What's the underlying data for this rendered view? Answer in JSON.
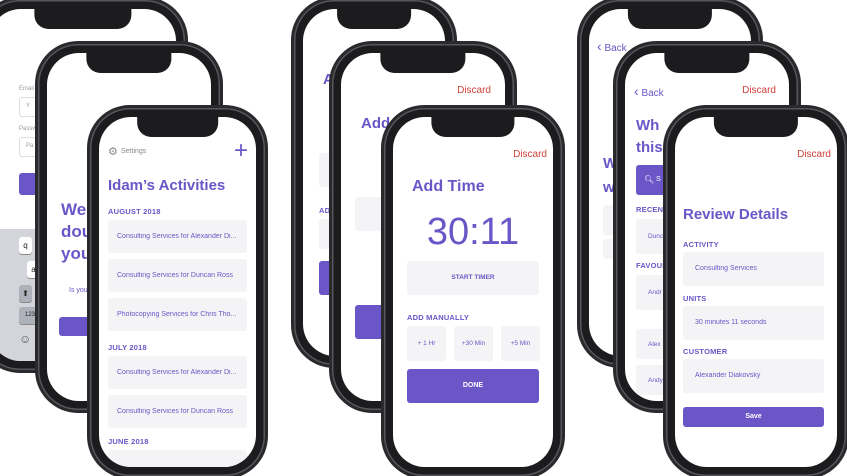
{
  "colors": {
    "accent": "#6a56c7",
    "danger": "#d0403a",
    "card": "#f4f4f6"
  },
  "login": {
    "label_email": "Email",
    "label_password": "Passw",
    "input_email_placeholder": "Y",
    "input_password_placeholder": "Pa",
    "keys": [
      "q",
      "w",
      "a",
      "123"
    ]
  },
  "welcome": {
    "title_lines": [
      "We",
      "dou",
      "you"
    ],
    "body_text": "Is you"
  },
  "activities": {
    "settings_label": "Settings",
    "title": "Idam’s Activities",
    "sections": [
      {
        "heading": "AUGUST 2018",
        "items": [
          "Consulting Services for Alexander Di...",
          "Consulting Services for Duncan Ross",
          "Photocopying Services for Chris Tho..."
        ]
      },
      {
        "heading": "JULY 2018",
        "items": [
          "Consulting Services for Alexander Di...",
          "Consulting Services for Duncan Ross"
        ]
      },
      {
        "heading": "JUNE 2018",
        "items": []
      }
    ]
  },
  "back_add": {
    "title_fragment": "Ad",
    "adi_label": "ADI",
    "discard": "Discard"
  },
  "mid_add": {
    "title_fragment": "Add",
    "adi_label": "ADI",
    "discard": "Discard"
  },
  "add_time": {
    "discard": "Discard",
    "title": "Add Time",
    "timer": "30:11",
    "start_timer": "START TIMER",
    "add_manually": "ADD MANUALLY",
    "increments": [
      "+ 1 Hr",
      "+30 Min",
      "+5 Min"
    ],
    "done": "DONE"
  },
  "back_search": {
    "back": "Back",
    "discard": "Discard",
    "title_fragment_1": "W",
    "title_fragment_2": "w"
  },
  "search": {
    "back": "Back",
    "discard": "Discard",
    "title_lines": [
      "Wh",
      "this"
    ],
    "search_label": "S",
    "recent_label": "RECENT",
    "recent_item": "Dunca",
    "favourites_label": "FAVOUR",
    "fav_item": "Andr",
    "other_items": [
      "Alex",
      "Andy"
    ]
  },
  "review": {
    "discard": "Discard",
    "title": "Review Details",
    "activity_label": "ACTIVITY",
    "activity_value": "Consulting Services",
    "units_label": "UNITS",
    "units_value": "30 minutes 11 seconds",
    "customer_label": "CUSTOMER",
    "customer_value": "Alexander Diakovsky",
    "save": "Save"
  }
}
